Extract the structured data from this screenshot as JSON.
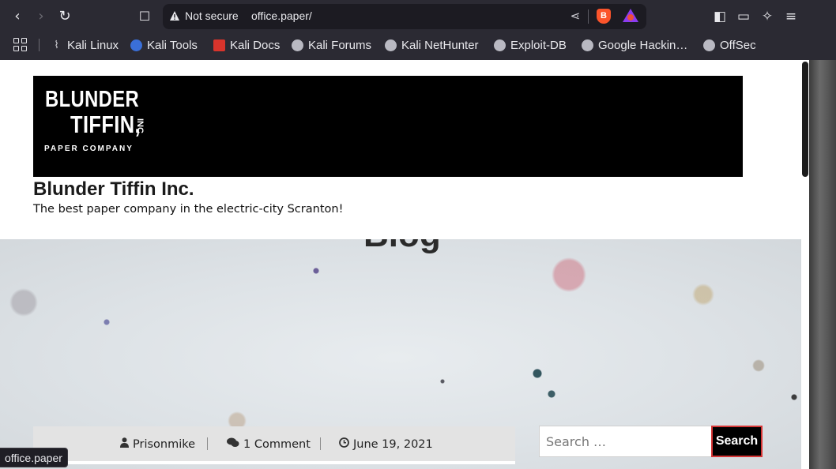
{
  "browser": {
    "security_label": "Not secure",
    "url": "office.paper/",
    "status_url": "office.paper"
  },
  "bookmarks": [
    {
      "label": "Kali Linux",
      "icon": "kali-dragon-icon"
    },
    {
      "label": "Kali Tools",
      "icon": "kali-tools-icon"
    },
    {
      "label": "Kali Docs",
      "icon": "kali-docs-icon"
    },
    {
      "label": "Kali Forums",
      "icon": "globe-icon"
    },
    {
      "label": "Kali NetHunter",
      "icon": "globe-icon"
    },
    {
      "label": "Exploit-DB",
      "icon": "globe-icon"
    },
    {
      "label": "Google Hackin…",
      "icon": "globe-icon"
    },
    {
      "label": "OffSec",
      "icon": "globe-icon"
    }
  ],
  "logo": {
    "line1": "BLUNDER",
    "line2": "TIFFIN,",
    "inc": "INC",
    "sub": "PAPER COMPANY"
  },
  "site": {
    "title": "Blunder Tiffin Inc.",
    "tagline": "The best paper company in the electric-city Scranton!",
    "hero_title_fragment": "Blog"
  },
  "post_meta": {
    "author": "Prisonmike",
    "comments": "1 Comment",
    "date": "June 19, 2021"
  },
  "search": {
    "placeholder": "Search …",
    "button_label": "Search"
  },
  "colors": {
    "browser_chrome": "#2b2a33",
    "url_field": "#1c1b22",
    "banner": "#000000",
    "meta_bar": "#e3e3e3",
    "search_button_border": "#d63636"
  }
}
